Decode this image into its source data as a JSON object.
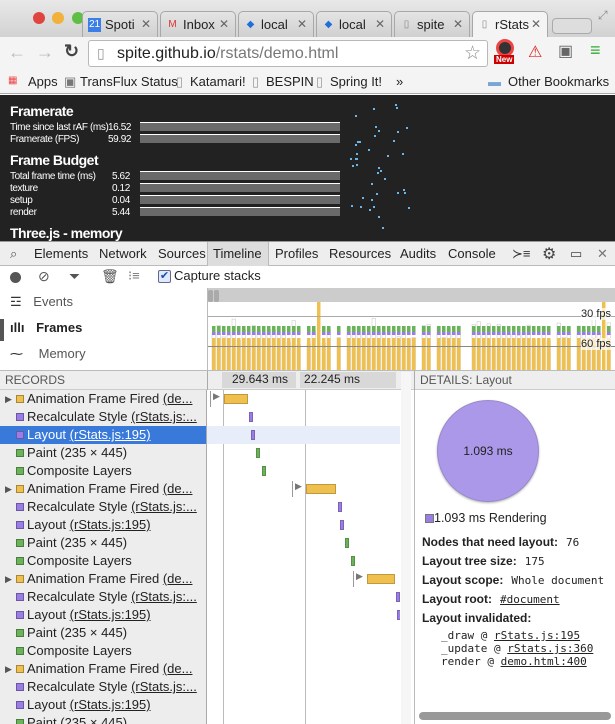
{
  "browser": {
    "tabs": [
      {
        "label": "Spoti",
        "icon": "calendar-icon"
      },
      {
        "label": "Inbox",
        "icon": "gmail-icon"
      },
      {
        "label": "local",
        "icon": "diamond-icon"
      },
      {
        "label": "local",
        "icon": "diamond-icon"
      },
      {
        "label": "spite",
        "icon": "page-icon"
      },
      {
        "label": "rStats",
        "icon": "page-icon",
        "active": true
      }
    ],
    "url_host": "spite.github.io",
    "url_path": "/rstats/demo.html",
    "extension_badge": "New",
    "bookmarks": [
      "Apps",
      "TransFlux Status",
      "Katamari!",
      "BESPIN",
      "Spring It!"
    ],
    "overflow": "»",
    "other_bookmarks": "Other Bookmarks"
  },
  "page": {
    "framerate_title": "Framerate",
    "framerate": [
      {
        "label": "Time since last rAF (ms)",
        "value": "16.52"
      },
      {
        "label": "Framerate (FPS)",
        "value": "59.92"
      }
    ],
    "budget_title": "Frame Budget",
    "budget": [
      {
        "label": "Total frame time (ms)",
        "value": "5.62"
      },
      {
        "label": "texture",
        "value": "0.12"
      },
      {
        "label": "setup",
        "value": "0.04"
      },
      {
        "label": "render",
        "value": "5.44"
      }
    ],
    "memory_title": "Three.js - memory"
  },
  "devtools": {
    "tabs": [
      "Elements",
      "Network",
      "Sources",
      "Timeline",
      "Profiles",
      "Resources",
      "Audits",
      "Console"
    ],
    "active_tab": "Timeline",
    "capture_stacks": "Capture stacks",
    "capture_checked": true,
    "modes": [
      "Events",
      "Frames",
      "Memory"
    ],
    "active_mode": "Frames",
    "fps_30": "30 fps",
    "fps_60": "60 fps",
    "records_header": "RECORDS",
    "time1": "29.643 ms",
    "time2": "22.245 ms",
    "details_header": "DETAILS: Layout",
    "colors": {
      "scripting": "#f0c04f",
      "rendering": "#9a7ee6",
      "painting": "#6bb35a",
      "selected": "#3879d9"
    }
  },
  "records": [
    {
      "kind": "scripting",
      "expand": true,
      "name": "Animation Frame Fired",
      "link": "(de..."
    },
    {
      "kind": "rendering",
      "name": "Recalculate Style",
      "link": "(rStats.js:..."
    },
    {
      "kind": "rendering",
      "name": "Layout",
      "link": "(rStats.js:195)",
      "selected": true
    },
    {
      "kind": "painting",
      "name": "Paint (235 × 445)",
      "link": ""
    },
    {
      "kind": "painting",
      "name": "Composite Layers",
      "link": ""
    },
    {
      "kind": "scripting",
      "expand": true,
      "name": "Animation Frame Fired",
      "link": "(de..."
    },
    {
      "kind": "rendering",
      "name": "Recalculate Style",
      "link": "(rStats.js:..."
    },
    {
      "kind": "rendering",
      "name": "Layout",
      "link": "(rStats.js:195)"
    },
    {
      "kind": "painting",
      "name": "Paint (235 × 445)",
      "link": ""
    },
    {
      "kind": "painting",
      "name": "Composite Layers",
      "link": ""
    },
    {
      "kind": "scripting",
      "expand": true,
      "name": "Animation Frame Fired",
      "link": "(de..."
    },
    {
      "kind": "rendering",
      "name": "Recalculate Style",
      "link": "(rStats.js:..."
    },
    {
      "kind": "rendering",
      "name": "Layout",
      "link": "(rStats.js:195)"
    },
    {
      "kind": "painting",
      "name": "Paint (235 × 445)",
      "link": ""
    },
    {
      "kind": "painting",
      "name": "Composite Layers",
      "link": ""
    },
    {
      "kind": "scripting",
      "expand": true,
      "name": "Animation Frame Fired",
      "link": "(de..."
    },
    {
      "kind": "rendering",
      "name": "Recalculate Style",
      "link": "(rStats.js:..."
    },
    {
      "kind": "rendering",
      "name": "Layout",
      "link": "(rStats.js:195)"
    },
    {
      "kind": "painting",
      "name": "Paint (235 × 445)",
      "link": ""
    }
  ],
  "details": {
    "pie_label": "1.093 ms",
    "legend": "1.093 ms Rendering",
    "nodes_label": "Nodes that need layout:",
    "nodes": "76",
    "tree_label": "Layout tree size:",
    "tree": "175",
    "scope_label": "Layout scope:",
    "scope": "Whole document",
    "root_label": "Layout root:",
    "root": "#document",
    "invalidated_label": "Layout invalidated:",
    "stack": [
      {
        "fn": "_draw @ ",
        "loc": "rStats.js:195"
      },
      {
        "fn": "_update @ ",
        "loc": "rStats.js:360"
      },
      {
        "fn": "render @ ",
        "loc": "demo.html:400"
      }
    ]
  }
}
